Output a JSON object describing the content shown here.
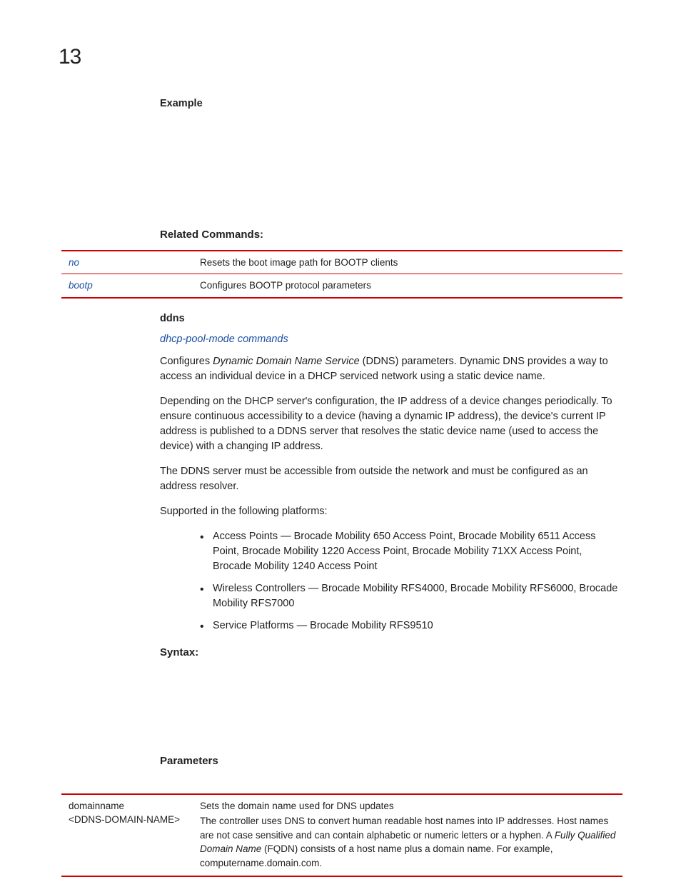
{
  "page_number": "13",
  "sections": {
    "example_heading": "Example",
    "related_heading": "Related Commands:",
    "related_rows": [
      {
        "cmd": "no",
        "desc": "Resets the boot image path for BOOTP clients"
      },
      {
        "cmd": "bootp",
        "desc": "Configures BOOTP protocol parameters"
      }
    ],
    "ddns_heading": "ddns",
    "ddns_link": "dhcp-pool-mode commands",
    "ddns_p1_pre": "Configures ",
    "ddns_p1_em": "Dynamic Domain Name Service",
    "ddns_p1_post": " (DDNS) parameters. Dynamic DNS provides a way to access an individual device in a DHCP serviced network using a static device name.",
    "ddns_p2": "Depending on the DHCP server's configuration, the IP address of a device changes periodically. To ensure continuous accessibility to a device (having a dynamic IP address), the device's current IP address is published to a DDNS server that resolves the static device name (used to access the device) with a changing IP address.",
    "ddns_p3": "The DDNS server must be accessible from outside the network and must be configured as an address resolver.",
    "ddns_supported_intro": "Supported in the following platforms:",
    "platforms": [
      "Access Points — Brocade Mobility 650 Access Point, Brocade Mobility 6511 Access Point, Brocade Mobility 1220 Access Point, Brocade Mobility 71XX Access Point, Brocade Mobility 1240 Access Point",
      "Wireless Controllers — Brocade Mobility RFS4000, Brocade Mobility RFS6000, Brocade Mobility RFS7000",
      "Service Platforms — Brocade Mobility RFS9510"
    ],
    "syntax_heading": "Syntax:",
    "params_heading": "Parameters",
    "params_rows": [
      {
        "param_l1": "domainname",
        "param_l2": "<DDNS-DOMAIN-NAME>",
        "desc_l1": "Sets the domain name used for DNS updates",
        "desc_l2_pre": "The controller uses DNS to convert human readable host names into IP addresses. Host names are not case sensitive and can contain alphabetic or numeric letters or a hyphen. A ",
        "desc_l2_em": "Fully Qualified Domain Name",
        "desc_l2_post": " (FQDN) consists of a host name plus a domain name. For example, computername.domain.com."
      }
    ]
  }
}
